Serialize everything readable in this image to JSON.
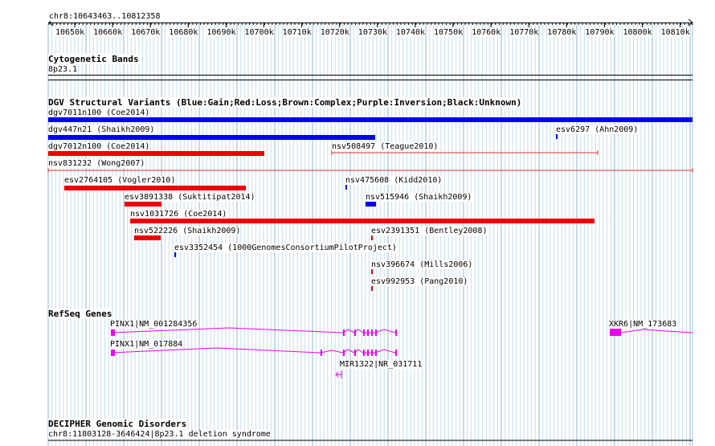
{
  "ruler": {
    "coords": "chr8:10643463..10812358",
    "ticks": [
      "10650k",
      "10660k",
      "10670k",
      "10680k",
      "10690k",
      "10700k",
      "10710k",
      "10720k",
      "10730k",
      "10740k",
      "10750k",
      "10760k",
      "10770k",
      "10780k",
      "10790k",
      "10800k",
      "10810k"
    ]
  },
  "cytoband": {
    "title": "Cytogenetic Bands",
    "band": "8p23.1"
  },
  "dgv": {
    "title": "DGV Structural Variants (Blue:Gain;Red:Loss;Brown:Complex;Purple:Inversion;Black:Unknown)",
    "colors": {
      "gain": "#0000ee",
      "loss": "#ee0000",
      "thin_loss": "#dd3333"
    },
    "variants": [
      {
        "label": "dgv7011n100 (Coe2014)",
        "type": "gain"
      },
      {
        "label": "dgv447n21 (Shaikh2009)",
        "type": "gain"
      },
      {
        "label": "esv6297 (Ahn2009)",
        "type": "gain"
      },
      {
        "label": "dgv7012n100 (Coe2014)",
        "type": "loss"
      },
      {
        "label": "nsv508497 (Teague2010)",
        "type": "loss"
      },
      {
        "label": "nsv831232 (Wong2007)",
        "type": "loss"
      },
      {
        "label": "esv2764105 (Vogler2010)",
        "type": "loss"
      },
      {
        "label": "nsv475608 (Kidd2010)",
        "type": "gain"
      },
      {
        "label": "esv3891338 (Suktitipat2014)",
        "type": "loss"
      },
      {
        "label": "nsv515946 (Shaikh2009)",
        "type": "gain"
      },
      {
        "label": "nsv1031726 (Coe2014)",
        "type": "loss"
      },
      {
        "label": "nsv522226 (Shaikh2009)",
        "type": "loss"
      },
      {
        "label": "esv2391351 (Bentley2008)",
        "type": "loss"
      },
      {
        "label": "esv3352454 (1000GenomesConsortiumPilotProject)",
        "type": "gain"
      },
      {
        "label": "nsv396674 (Mills2006)",
        "type": "loss"
      },
      {
        "label": "esv992953 (Pang2010)",
        "type": "loss"
      }
    ]
  },
  "refseq": {
    "title": "RefSeq Genes",
    "color": "#ee00ee",
    "genes": [
      {
        "label": "PINX1|NM_001284356"
      },
      {
        "label": "PINX1|NM_017884"
      },
      {
        "label": "MIR1322|NR_031711"
      },
      {
        "label": "XKR6|NM_173683"
      }
    ]
  },
  "decipher": {
    "title": "DECIPHER Genomic Disorders",
    "region": "chr8:11803128-3646424|8p23.1 deletion syndrome"
  }
}
